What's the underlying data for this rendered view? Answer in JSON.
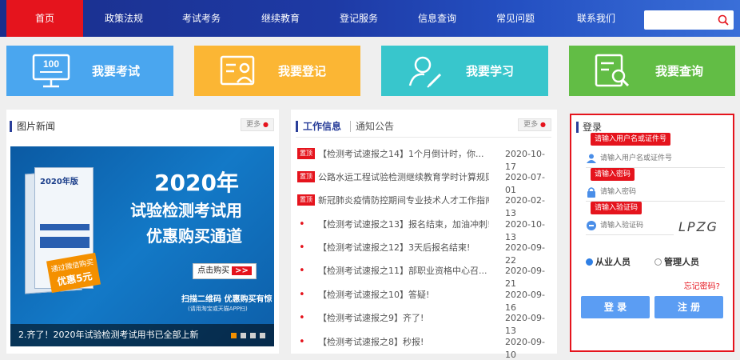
{
  "nav": {
    "items": [
      "首页",
      "政策法规",
      "考试考务",
      "继续教育",
      "登记服务",
      "信息查询",
      "常见问题",
      "联系我们"
    ],
    "search_placeholder": ""
  },
  "tiles": [
    {
      "label": "我要考试",
      "color": "#4aa6ef",
      "icon": "monitor-icon",
      "icon_text": "100"
    },
    {
      "label": "我要登记",
      "color": "#fbb634",
      "icon": "register-card-icon"
    },
    {
      "label": "我要学习",
      "color": "#38c6cc",
      "icon": "learn-user-icon"
    },
    {
      "label": "我要查询",
      "color": "#62bd45",
      "icon": "search-doc-icon"
    }
  ],
  "photo_news": {
    "title": "图片新闻",
    "more": "更多",
    "banner": {
      "book_title": "2020年版",
      "line1": "2020年",
      "line2": "试验检测考试用",
      "line3": "优惠购买通道",
      "buy": "点击购买",
      "buy_arrow": ">>",
      "promo_top": "通过微信购买",
      "promo_bottom": "优惠5元",
      "scan": "扫描二维码 优惠购买有惊",
      "scan_sub": "(请用淘宝或天猫APP扫)",
      "caption": "2.齐了！2020年试验检测考试用书已全部上新"
    }
  },
  "news": {
    "tabs": [
      "工作信息",
      "通知公告"
    ],
    "more": "更多",
    "badge": "置顶",
    "rows": [
      {
        "pinned": true,
        "text": "【检测考试速报之14】1个月倒计时，你...",
        "date": "2020-10-17"
      },
      {
        "pinned": true,
        "text": "公路水运工程试验检测继续教育学时计算规则",
        "date": "2020-07-01"
      },
      {
        "pinned": true,
        "text": "新冠肺炎疫情防控期间专业技术人才工作指南",
        "date": "2020-02-13"
      },
      {
        "pinned": false,
        "text": "【检测考试速报之13】报名结束，加油冲刺!",
        "date": "2020-10-13"
      },
      {
        "pinned": false,
        "text": "【检测考试速报之12】3天后报名结束!",
        "date": "2020-09-22"
      },
      {
        "pinned": false,
        "text": "【检测考试速报之11】部职业资格中心召...",
        "date": "2020-09-21"
      },
      {
        "pinned": false,
        "text": "【检测考试速报之10】答疑!",
        "date": "2020-09-16"
      },
      {
        "pinned": false,
        "text": "【检测考试速报之9】齐了!",
        "date": "2020-09-13"
      },
      {
        "pinned": false,
        "text": "【检测考试速报之8】秒报!",
        "date": "2020-09-10"
      }
    ]
  },
  "login": {
    "title": "登录",
    "tip_user": "请输入用户名或证件号",
    "user_placeholder": "请输入用户名或证件号",
    "tip_pwd": "请输入密码",
    "pwd_placeholder": "请输入密码",
    "tip_code": "请输入验证码",
    "code_placeholder": "请输入验证码",
    "captcha": "LPZG",
    "role_employee": "从业人员",
    "role_admin": "管理人员",
    "forgot": "忘记密码?",
    "login_btn": "登 录",
    "register_btn": "注 册"
  }
}
